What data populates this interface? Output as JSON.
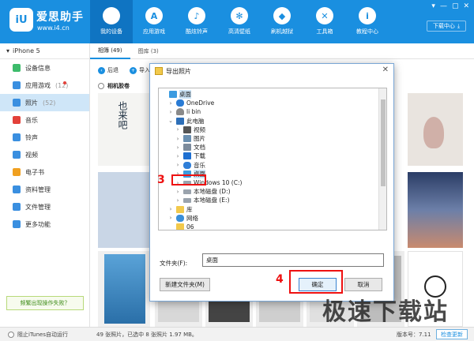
{
  "app": {
    "logo_text": "iU",
    "name": "爱思助手",
    "url": "www.i4.cn",
    "window_controls": [
      "▾",
      "—",
      "▢",
      "✕"
    ],
    "download_center": "下载中心",
    "download_icon": "⤓"
  },
  "nav": {
    "items": [
      {
        "label": "我的设备",
        "icon": "apple-icon",
        "glyph": "",
        "active": true
      },
      {
        "label": "应用游戏",
        "icon": "app-store-icon",
        "glyph": "A",
        "active": false
      },
      {
        "label": "酷炫铃声",
        "icon": "bell-icon",
        "glyph": "♪",
        "active": false
      },
      {
        "label": "高清壁纸",
        "icon": "snowflake-icon",
        "glyph": "✻",
        "active": false
      },
      {
        "label": "刷机越狱",
        "icon": "dropbox-icon",
        "glyph": "◆",
        "active": false
      },
      {
        "label": "工具箱",
        "icon": "tools-icon",
        "glyph": "✕",
        "active": false
      },
      {
        "label": "教程中心",
        "icon": "info-icon",
        "glyph": "i",
        "active": false
      }
    ]
  },
  "device": {
    "name": "iPhone 5",
    "chevron": "▾"
  },
  "sidebar": {
    "items": [
      {
        "label": "设备信息",
        "count": "",
        "icon": "info-circle-icon",
        "color": "#3dbb6b",
        "active": false,
        "badge": false
      },
      {
        "label": "应用游戏",
        "count": "(12)",
        "icon": "app-icon",
        "color": "#3a8fe0",
        "active": false,
        "badge": true
      },
      {
        "label": "照片",
        "count": "(52)",
        "icon": "photo-icon",
        "color": "#3a8fe0",
        "active": true,
        "badge": false
      },
      {
        "label": "音乐",
        "count": "",
        "icon": "music-icon",
        "color": "#e3413a",
        "active": false,
        "badge": false
      },
      {
        "label": "铃声",
        "count": "",
        "icon": "bell-icon",
        "color": "#3a8fe0",
        "active": false,
        "badge": false
      },
      {
        "label": "视频",
        "count": "",
        "icon": "video-icon",
        "color": "#3a8fe0",
        "active": false,
        "badge": false
      },
      {
        "label": "电子书",
        "count": "",
        "icon": "book-icon",
        "color": "#f0a020",
        "active": false,
        "badge": false
      },
      {
        "label": "资料管理",
        "count": "",
        "icon": "contacts-icon",
        "color": "#3a8fe0",
        "active": false,
        "badge": false
      },
      {
        "label": "文件管理",
        "count": "",
        "icon": "file-icon",
        "color": "#3a8fe0",
        "active": false,
        "badge": false
      },
      {
        "label": "更多功能",
        "count": "",
        "icon": "grid-icon",
        "color": "#3a8fe0",
        "active": false,
        "badge": false
      }
    ],
    "help_link": "频繁出现操作失败？"
  },
  "tabs": [
    {
      "label": "相簿 (49)",
      "active": true
    },
    {
      "label": "图库 (3)",
      "active": false
    }
  ],
  "toolbar": {
    "back": "后退",
    "import": "导入"
  },
  "album": {
    "label": "相机胶卷"
  },
  "dialog": {
    "title": "导出照片",
    "close": "✕",
    "tree": [
      {
        "label": "桌面",
        "indent": 0,
        "icon": "desktop-icon",
        "cls": "ico-desk",
        "chev": "",
        "selected": true
      },
      {
        "label": "OneDrive",
        "indent": 1,
        "icon": "onedrive-icon",
        "cls": "ico-cloud",
        "chev": "›",
        "selected": false
      },
      {
        "label": "li bin",
        "indent": 1,
        "icon": "user-icon",
        "cls": "ico-user",
        "chev": "›",
        "selected": false
      },
      {
        "label": "此电脑",
        "indent": 1,
        "icon": "computer-icon",
        "cls": "ico-pc",
        "chev": "⌄",
        "selected": false
      },
      {
        "label": "视频",
        "indent": 2,
        "icon": "video-folder-icon",
        "cls": "ico-video",
        "chev": "›",
        "selected": false
      },
      {
        "label": "图片",
        "indent": 2,
        "icon": "pictures-folder-icon",
        "cls": "ico-pic",
        "chev": "›",
        "selected": false
      },
      {
        "label": "文档",
        "indent": 2,
        "icon": "documents-folder-icon",
        "cls": "ico-doc",
        "chev": "›",
        "selected": false
      },
      {
        "label": "下载",
        "indent": 2,
        "icon": "downloads-folder-icon",
        "cls": "ico-down",
        "chev": "›",
        "selected": false
      },
      {
        "label": "音乐",
        "indent": 2,
        "icon": "music-folder-icon",
        "cls": "ico-music",
        "chev": "›",
        "selected": false
      },
      {
        "label": "桌面",
        "indent": 2,
        "icon": "desktop-folder-icon",
        "cls": "ico-desk",
        "chev": "›",
        "selected": true
      },
      {
        "label": "Windows 10 (C:)",
        "indent": 2,
        "icon": "drive-icon",
        "cls": "ico-drive",
        "chev": "›",
        "selected": false
      },
      {
        "label": "本地磁盘 (D:)",
        "indent": 2,
        "icon": "drive-icon",
        "cls": "ico-drive",
        "chev": "›",
        "selected": false
      },
      {
        "label": "本地磁盘 (E:)",
        "indent": 2,
        "icon": "drive-icon",
        "cls": "ico-drive",
        "chev": "›",
        "selected": false
      },
      {
        "label": "库",
        "indent": 1,
        "icon": "library-icon",
        "cls": "ico-folder",
        "chev": "›",
        "selected": false
      },
      {
        "label": "网络",
        "indent": 1,
        "icon": "network-icon",
        "cls": "ico-net",
        "chev": "›",
        "selected": false
      },
      {
        "label": "06",
        "indent": 1,
        "icon": "folder-icon",
        "cls": "ico-folder",
        "chev": "",
        "selected": false
      }
    ],
    "folder_label": "文件夹(F):",
    "folder_value": "桌面",
    "new_folder_button": "新建文件夹(M)",
    "ok_button": "确定",
    "cancel_button": "取消",
    "step3": "3",
    "step4": "4"
  },
  "status": {
    "itunes_toggle": "阻止iTunes自动运行",
    "summary": "49 张照片，已选中 8 张照片 1.97 MB。",
    "version": "版本号：7.11",
    "update_button": "检查更新"
  },
  "watermark": "极速下载站",
  "photo_text": "也来吧",
  "accent_color": "#1a8fe0"
}
